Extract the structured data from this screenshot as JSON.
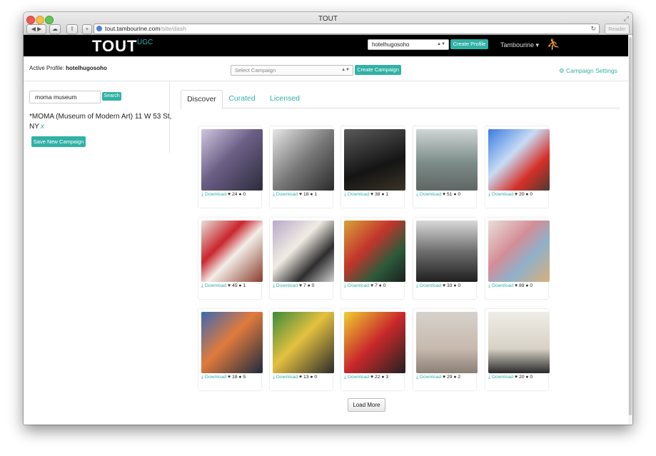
{
  "window": {
    "title": "TOUT"
  },
  "browser": {
    "url_host": "tout.tambourine.com",
    "url_path": "/site/dash",
    "reader_label": "Reader",
    "back_icon": "back-arrow-icon",
    "forward_icon": "forward-arrow-icon"
  },
  "header": {
    "logo": "TOUT",
    "logo_sub": "UGC",
    "profile_selected": "hotelhugosoho",
    "create_profile_label": "Create Profile",
    "account_menu_label": "Tambourine ▾",
    "brand_icon": "figure-icon"
  },
  "subbar": {
    "active_profile_label": "Active Profile:",
    "active_profile_value": "hotelhugosoho",
    "campaign_placeholder": "Select Campaign",
    "create_campaign_label": "Create Campaign",
    "campaign_settings_label": "Campaign Settings"
  },
  "sidebar": {
    "search_value": "moma museum",
    "search_button": "Search",
    "campaign_location": "*MOMA (Museum of Modern Art) 11 W 53 St, NY",
    "remove_label": "x",
    "save_campaign_label": "Save New Campaign"
  },
  "tabs": [
    {
      "label": "Discover",
      "active": true
    },
    {
      "label": "Curated",
      "active": false
    },
    {
      "label": "Licensed",
      "active": false
    }
  ],
  "colors": {
    "accent": "#31b1a6",
    "header_bg": "#000000"
  },
  "download_label": "Download",
  "cards": [
    {
      "likes": "24",
      "comments": "0",
      "bg": "linear-gradient(135deg,#cfc6df,#6c5f86 45%,#2c2c3c)"
    },
    {
      "likes": "18",
      "comments": "1",
      "bg": "linear-gradient(135deg,#e6e6e6,#7a7a7a 50%,#2a2a2a)"
    },
    {
      "likes": "38",
      "comments": "1",
      "bg": "linear-gradient(160deg,#5a5a5a,#141414 60%,#3a3428)"
    },
    {
      "likes": "51",
      "comments": "0",
      "bg": "linear-gradient(180deg,#cfd6d5,#7c8c88 55%,#5f6664)"
    },
    {
      "likes": "20",
      "comments": "0",
      "bg": "linear-gradient(135deg,#3a7be0,#c8dcf5 40%,#d63028 70%,#4a3a30)"
    },
    {
      "likes": "45",
      "comments": "1",
      "bg": "linear-gradient(135deg,#e8e0da,#c9262d 35%,#f2efe9 55%,#8a3a2a)"
    },
    {
      "likes": "7",
      "comments": "0",
      "bg": "linear-gradient(135deg,#b8a9c9,#f1ece4 40%,#2e2e2e 70%,#cfcfcf)"
    },
    {
      "likes": "7",
      "comments": "0",
      "bg": "linear-gradient(135deg,#d8a23a,#c3352b 40%,#2a5a3a 70%,#1d1d1d)"
    },
    {
      "likes": "33",
      "comments": "0",
      "bg": "linear-gradient(180deg,#d9d9d9,#6f6f6f 50%,#1f1f1f)"
    },
    {
      "likes": "89",
      "comments": "0",
      "bg": "linear-gradient(135deg,#e9dfd9,#d48d98 40%,#8fb1c9 65%,#d9b07a)"
    },
    {
      "likes": "18",
      "comments": "5",
      "bg": "linear-gradient(135deg,#3d68b5,#e07b3c 45%,#1e2a3e)"
    },
    {
      "likes": "13",
      "comments": "0",
      "bg": "linear-gradient(135deg,#3c8a3c,#e4c13f 45%,#2a2a2a)"
    },
    {
      "likes": "22",
      "comments": "3",
      "bg": "linear-gradient(135deg,#f0d030,#c8282b 50%,#222)"
    },
    {
      "likes": "29",
      "comments": "2",
      "bg": "linear-gradient(180deg,#d6d2cc,#c7b9ad 60%,#8a8076)"
    },
    {
      "likes": "20",
      "comments": "0",
      "bg": "linear-gradient(180deg,#efede7,#d8d2c6 60%,#2a2a2a)"
    }
  ],
  "load_more_label": "Load More"
}
